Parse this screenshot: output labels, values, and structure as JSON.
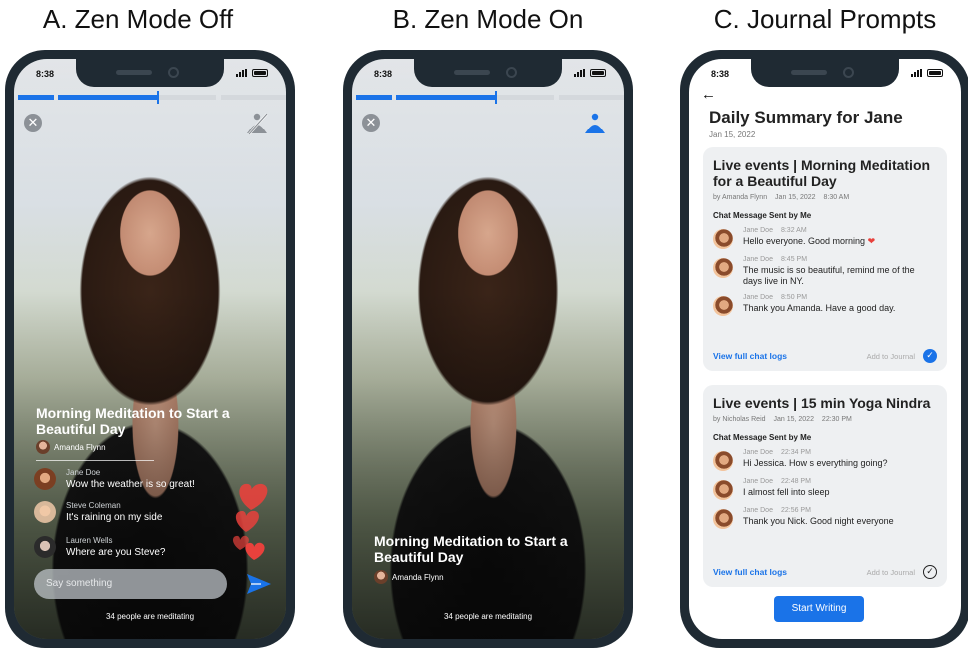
{
  "panels": {
    "a_title": "A. Zen Mode Off",
    "b_title": "B. Zen Mode On",
    "c_title": "C. Journal Prompts"
  },
  "status": {
    "time": "8:38"
  },
  "live": {
    "title": "Morning Meditation to Start a Beautiful Day",
    "host": "Amanda Flynn",
    "meditating": "34 people are meditating",
    "input_placeholder": "Say something",
    "chat": [
      {
        "name": "Jane Doe",
        "message": "Wow the weather is so great!"
      },
      {
        "name": "Steve Coleman",
        "message": "It's raining on my side"
      },
      {
        "name": "Lauren Wells",
        "message": "Where are you Steve?"
      }
    ]
  },
  "journal": {
    "title": "Daily Summary for Jane",
    "date": "Jan 15, 2022",
    "start_button": "Start Writing",
    "cards": [
      {
        "title": "Live events | Morning Meditation for a Beautiful Day",
        "by": "by Amanda Flynn",
        "date": "Jan 15, 2022",
        "time": "8:30 AM",
        "section": "Chat Message Sent by Me",
        "messages": [
          {
            "name": "Jane Doe",
            "time": "8:32 AM",
            "text": "Hello everyone. Good morning"
          },
          {
            "name": "Jane Doe",
            "time": "8:45 PM",
            "text": "The music is so beautiful, remind me of the days live in NY."
          },
          {
            "name": "Jane Doe",
            "time": "8:50 PM",
            "text": "Thank you Amanda. Have a good day."
          }
        ],
        "link": "View full chat logs",
        "add": "Add to Journal",
        "added": true
      },
      {
        "title": "Live events | 15 min Yoga Nindra",
        "by": "by Nicholas Reid",
        "date": "Jan 15, 2022",
        "time": "22:30 PM",
        "section": "Chat Message Sent by Me",
        "messages": [
          {
            "name": "Jane Doe",
            "time": "22:34 PM",
            "text": "Hi Jessica. How s everything going?"
          },
          {
            "name": "Jane Doe",
            "time": "22:48 PM",
            "text": "I almost fell into sleep"
          },
          {
            "name": "Jane Doe",
            "time": "22:56 PM",
            "text": "Thank you Nick. Good night everyone"
          }
        ],
        "link": "View full chat logs",
        "add": "Add to Journal",
        "added": false
      }
    ]
  },
  "colors": {
    "accent": "#1a73e8",
    "phone": "#1f2a33",
    "heart": "#e8413c"
  },
  "icons": [
    "close-icon",
    "zen-off-icon",
    "zen-on-icon",
    "send-icon",
    "back-arrow-icon",
    "heart-icon",
    "check-icon"
  ]
}
